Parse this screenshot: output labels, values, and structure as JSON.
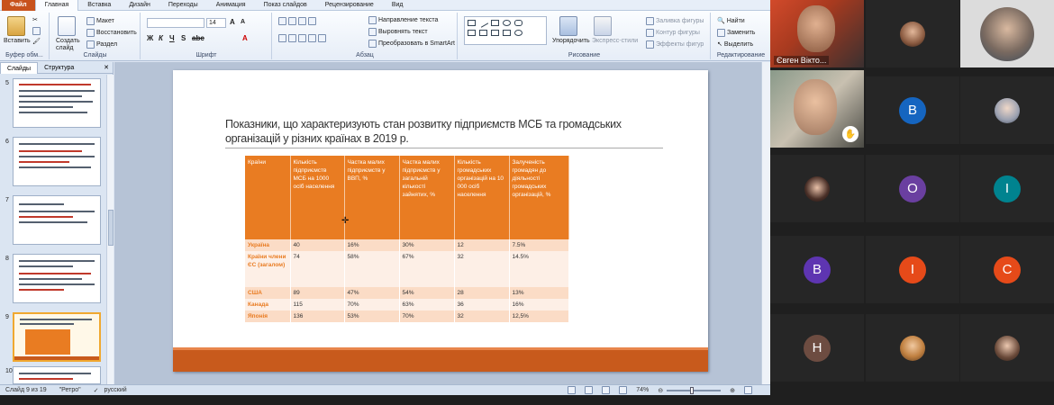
{
  "ribbon": {
    "file_tab": "Файл",
    "tabs": [
      "Главная",
      "Вставка",
      "Дизайн",
      "Переходы",
      "Анимация",
      "Показ слайдов",
      "Рецензирование",
      "Вид"
    ],
    "clipboard": {
      "paste": "Вставить",
      "group": "Буфер обм..."
    },
    "slides": {
      "new_slide": "Создать слайд",
      "layout": "Макет",
      "reset": "Восстановить",
      "section": "Раздел",
      "group": "Слайды"
    },
    "font": {
      "size": "14",
      "group": "Шрифт"
    },
    "paragraph": {
      "text_direction": "Направление текста",
      "align_text": "Выровнять текст",
      "smartart": "Преобразовать в SmartArt",
      "group": "Абзац"
    },
    "drawing": {
      "arrange": "Упорядочить",
      "quick_styles": "Экспресс-стили",
      "fill": "Заливка фигуры",
      "outline": "Контур фигуры",
      "effects": "Эффекты фигур",
      "group": "Рисование"
    },
    "editing": {
      "find": "Найти",
      "replace": "Заменить",
      "select": "Выделить",
      "group": "Редактирование"
    }
  },
  "left_pane": {
    "tabs": [
      "Слайды",
      "Структура"
    ],
    "slide_numbers": [
      "5",
      "6",
      "7",
      "8",
      "9",
      "10"
    ],
    "selected": "9"
  },
  "slide": {
    "title": "Показники, що характеризують стан розвитку підприємств МСБ та громадських організацій у різних країнах в 2019 р.",
    "table": {
      "headers": [
        "Країни",
        "Кількість підприємств МСБ на 1000 осіб населення",
        "Частка малих підприємств у ВВП, %",
        "Частка малих підприємств у загальній кількості зайнятих, %",
        "Кількість громадських організацій на 10 000 осіб населення",
        "Залученість громадян до діяльності громадських організацій, %"
      ],
      "rows": [
        [
          "Україна",
          "40",
          "16%",
          "30%",
          "12",
          "7.5%"
        ],
        [
          "Країни члени ЄС (загалом)",
          "74",
          "58%",
          "67%",
          "32",
          "14.5%"
        ],
        [
          "США",
          "89",
          "47%",
          "54%",
          "28",
          "13%"
        ],
        [
          "Канада",
          "115",
          "70%",
          "63%",
          "36",
          "16%"
        ],
        [
          "Японія",
          "136",
          "53%",
          "70%",
          "32",
          "12,5%"
        ]
      ]
    }
  },
  "status": {
    "slide_of": "Слайд 9 из 19",
    "theme": "\"Ретро\"",
    "language": "русский",
    "zoom": "74%"
  },
  "video": {
    "participants": [
      {
        "name": "Євген Вікто...",
        "type": "camera"
      },
      {
        "type": "photo"
      },
      {
        "type": "photo"
      },
      {
        "type": "camera",
        "raised_hand": true
      },
      {
        "initial": "B",
        "color": "#1565c0"
      },
      {
        "type": "photo"
      },
      {
        "type": "photo"
      },
      {
        "initial": "O",
        "color": "#6a3fa0"
      },
      {
        "initial": "I",
        "color": "#00838f"
      },
      {
        "initial": "B",
        "color": "#5e35b1"
      },
      {
        "initial": "I",
        "color": "#e64a19"
      },
      {
        "initial": "C",
        "color": "#e64a19"
      },
      {
        "initial": "H",
        "color": "#6d4c41"
      },
      {
        "type": "photo"
      },
      {
        "type": "photo"
      }
    ]
  },
  "colors": {
    "accent": "#e97c22",
    "footer": "#c85a1c",
    "file_tab": "#c8521c"
  }
}
